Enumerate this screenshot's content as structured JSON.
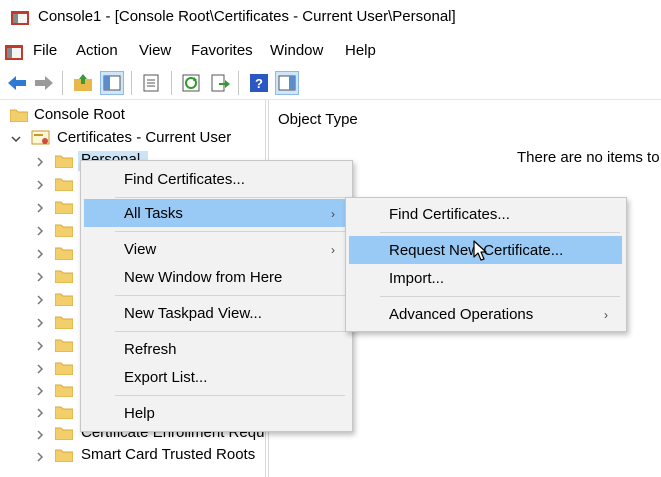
{
  "window": {
    "title": "Console1 - [Console Root\\Certificates - Current User\\Personal]"
  },
  "menubar": {
    "items": [
      "File",
      "Action",
      "View",
      "Favorites",
      "Window",
      "Help"
    ]
  },
  "toolbar": {
    "icons": [
      "back-icon",
      "forward-icon",
      "up-folder-icon",
      "show-hide-tree-icon",
      "properties-icon",
      "refresh-icon",
      "export-list-icon",
      "help-icon",
      "show-action-pane-icon"
    ]
  },
  "tree": {
    "root": "Console Root",
    "store": "Certificates - Current User",
    "personal": "Personal",
    "partial_item": "Certificate Enrollment Requ",
    "last_item": "Smart Card Trusted Roots"
  },
  "right_pane": {
    "column_header": "Object Type",
    "empty_text": "There are no items to"
  },
  "context_menu": {
    "find_certificates": "Find Certificates...",
    "all_tasks": "All Tasks",
    "view": "View",
    "new_window": "New Window from Here",
    "new_taskpad": "New Taskpad View...",
    "refresh": "Refresh",
    "export_list": "Export List...",
    "help": "Help"
  },
  "submenu": {
    "find_certificates": "Find Certificates...",
    "request_new": "Request New Certificate...",
    "import": "Import...",
    "advanced": "Advanced Operations"
  },
  "colors": {
    "highlight": "#99c9f5",
    "menu_bg": "#f2f2f2",
    "folder": "#f3cf6b"
  }
}
